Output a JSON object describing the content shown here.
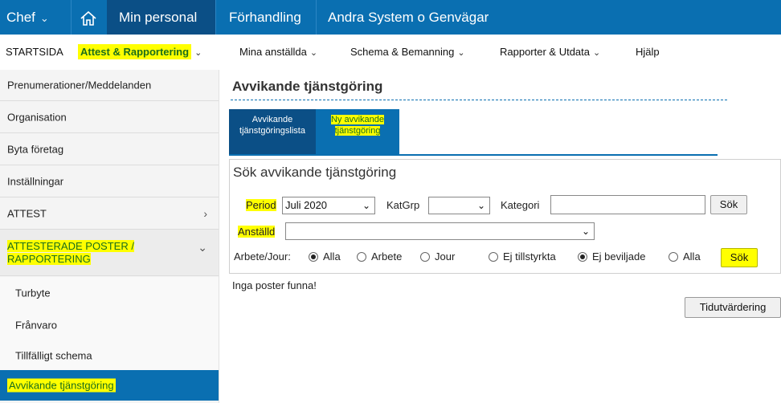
{
  "topbar": {
    "chef": "Chef",
    "home_icon": "home-icon",
    "items": [
      "Min personal",
      "Förhandling",
      "Andra System o Genvägar"
    ]
  },
  "nav2": {
    "items": [
      "STARTSIDA",
      "Attest & Rapportering",
      "Mina anställda",
      "Schema & Bemanning",
      "Rapporter & Utdata",
      "Hjälp"
    ]
  },
  "sidebar": {
    "items": [
      "Prenumerationer/Meddelanden",
      "Organisation",
      "Byta företag",
      "Inställningar",
      "ATTEST"
    ],
    "section_line1": "ATTESTERADE POSTER /",
    "section_line2": "RAPPORTERING",
    "sub_items": [
      "Turbyte",
      "Frånvaro",
      "Tillfälligt schema",
      "Avvikande tjänstgöring"
    ]
  },
  "main": {
    "title": "Avvikande tjänstgöring",
    "tab1_line1": "Avvikande",
    "tab1_line2": "tjänstgöringslista",
    "tab2_line1": "Ny avvikande",
    "tab2_line2": "tjänstgöring",
    "search_title": "Sök avvikande tjänstgöring",
    "period_label": "Period",
    "period_value": "Juli 2020",
    "katgrp_label": "KatGrp",
    "katgrp_value": "",
    "kategori_label": "Kategori",
    "kategori_value": "",
    "sok_button": "Sök",
    "anstalld_label": "Anställd",
    "anstalld_value": "",
    "arbete_label": "Arbete/Jour:",
    "radio_alla1": "Alla",
    "radio_arbete": "Arbete",
    "radio_jour": "Jour",
    "radio_ej_tillstyrkta": "Ej tillstyrkta",
    "radio_ej_beviljade": "Ej beviljade",
    "radio_alla2": "Alla",
    "sok_button2": "Sök",
    "no_results": "Inga poster funna!",
    "tidutvardering": "Tidutvärdering"
  },
  "colors": {
    "primary": "#0a6fb1",
    "primary_dark": "#0b4f86",
    "highlight": "#ffff00"
  }
}
